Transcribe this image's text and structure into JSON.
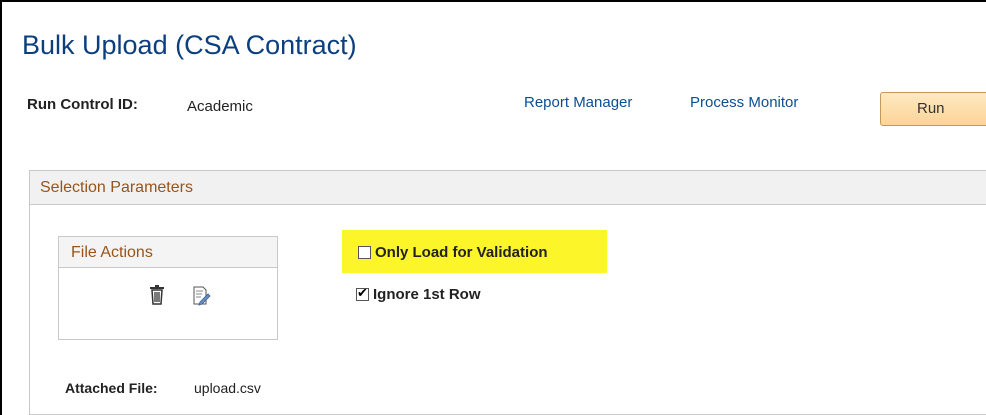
{
  "page": {
    "title": "Bulk Upload (CSA Contract)"
  },
  "run_control": {
    "label": "Run Control ID:",
    "value": "Academic"
  },
  "links": {
    "report_manager": "Report Manager",
    "process_monitor": "Process Monitor"
  },
  "run_button": {
    "label": "Run"
  },
  "selection": {
    "header": "Selection Parameters",
    "file_actions": {
      "header": "File Actions",
      "icons": [
        "trash-icon",
        "edit-icon"
      ]
    },
    "options": [
      {
        "label": "Only Load for Validation",
        "checked": false,
        "highlighted": true
      },
      {
        "label": "Ignore 1st Row",
        "checked": true
      }
    ],
    "attached_file": {
      "label": "Attached File:",
      "value": "upload.csv"
    }
  },
  "colors": {
    "title": "#0c3f7f",
    "link": "#0a4f96",
    "section_header_text": "#9a5418",
    "highlight": "#fbf52a",
    "run_button_bg": "#fbd497"
  }
}
